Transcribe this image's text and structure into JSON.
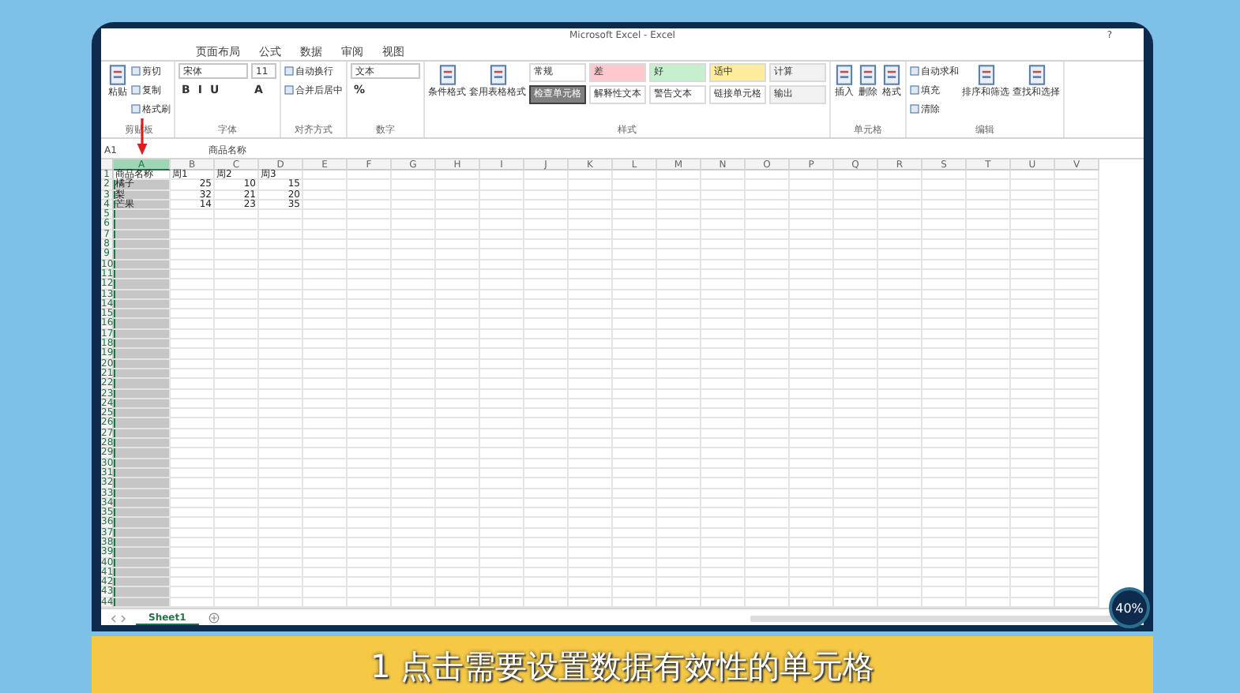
{
  "window": {
    "title": "Microsoft Excel - Excel",
    "help": "?"
  },
  "ribbon_tabs": [
    {
      "label": "页面布局"
    },
    {
      "label": "公式"
    },
    {
      "label": "数据"
    },
    {
      "label": "审阅"
    },
    {
      "label": "视图"
    }
  ],
  "ribbon_groups": [
    {
      "label": "剪贴板",
      "columns": [
        [
          {
            "kind": "large",
            "label": "粘贴"
          }
        ],
        [
          {
            "kind": "small",
            "label": "剪切"
          },
          {
            "kind": "small",
            "label": "复制"
          },
          {
            "kind": "small",
            "label": "格式刷"
          }
        ]
      ]
    },
    {
      "label": "字体",
      "columns": [
        [
          {
            "kind": "combo",
            "label": "宋体"
          },
          {
            "kind": "glyphs",
            "labels": [
              "B",
              "I",
              "U"
            ]
          }
        ],
        [
          {
            "kind": "size-combo",
            "label": "11"
          },
          {
            "kind": "glyphs",
            "labels": [
              "A"
            ]
          }
        ]
      ]
    },
    {
      "label": "对齐方式",
      "columns": [
        [
          {
            "kind": "small",
            "label": "自动换行"
          },
          {
            "kind": "small",
            "label": "合并后居中"
          }
        ]
      ]
    },
    {
      "label": "数字",
      "columns": [
        [
          {
            "kind": "combo",
            "label": "文本"
          },
          {
            "kind": "glyphs",
            "labels": [
              "%"
            ]
          }
        ]
      ]
    },
    {
      "label": "样式",
      "columns": [
        [
          {
            "kind": "large",
            "label": "条件格式"
          }
        ],
        [
          {
            "kind": "large",
            "label": "套用表格格式"
          }
        ],
        [
          {
            "kind": "style",
            "label": "常规",
            "color": "#ffffff",
            "dark": false
          },
          {
            "kind": "style",
            "label": "检查单元格",
            "color": "#7f7f7f",
            "dark": true
          }
        ],
        [
          {
            "kind": "style",
            "label": "差",
            "color": "#ffc7ce",
            "dark": false
          },
          {
            "kind": "style",
            "label": "解释性文本",
            "color": "#ffffff",
            "dark": false
          }
        ],
        [
          {
            "kind": "style",
            "label": "好",
            "color": "#c6efce",
            "dark": false
          },
          {
            "kind": "style",
            "label": "警告文本",
            "color": "#ffffff",
            "dark": false
          }
        ],
        [
          {
            "kind": "style",
            "label": "适中",
            "color": "#ffeb9c",
            "dark": false
          },
          {
            "kind": "style",
            "label": "链接单元格",
            "color": "#ffffff",
            "dark": false
          }
        ],
        [
          {
            "kind": "style",
            "label": "计算",
            "color": "#f2f2f2",
            "dark": false
          },
          {
            "kind": "style",
            "label": "输出",
            "color": "#f2f2f2",
            "dark": false
          }
        ]
      ]
    },
    {
      "label": "单元格",
      "columns": [
        [
          {
            "kind": "large",
            "label": "插入"
          }
        ],
        [
          {
            "kind": "large",
            "label": "删除"
          }
        ],
        [
          {
            "kind": "large",
            "label": "格式"
          }
        ]
      ]
    },
    {
      "label": "编辑",
      "columns": [
        [
          {
            "kind": "small",
            "label": "自动求和"
          },
          {
            "kind": "small",
            "label": "填充"
          },
          {
            "kind": "small",
            "label": "清除"
          }
        ],
        [
          {
            "kind": "large",
            "label": "排序和筛选"
          }
        ],
        [
          {
            "kind": "large",
            "label": "查找和选择"
          }
        ]
      ]
    }
  ],
  "name_box": "A1",
  "formula": "商品名称",
  "columns": [
    {
      "label": "A",
      "selected": true
    },
    {
      "label": "B",
      "selected": false
    },
    {
      "label": "C",
      "selected": false
    },
    {
      "label": "D",
      "selected": false
    },
    {
      "label": "E",
      "selected": false
    },
    {
      "label": "F",
      "selected": false
    },
    {
      "label": "G",
      "selected": false
    },
    {
      "label": "H",
      "selected": false
    },
    {
      "label": "I",
      "selected": false
    },
    {
      "label": "J",
      "selected": false
    },
    {
      "label": "K",
      "selected": false
    },
    {
      "label": "L",
      "selected": false
    },
    {
      "label": "M",
      "selected": false
    },
    {
      "label": "N",
      "selected": false
    },
    {
      "label": "O",
      "selected": false
    },
    {
      "label": "P",
      "selected": false
    },
    {
      "label": "Q",
      "selected": false
    },
    {
      "label": "R",
      "selected": false
    },
    {
      "label": "S",
      "selected": false
    },
    {
      "label": "T",
      "selected": false
    },
    {
      "label": "U",
      "selected": false
    },
    {
      "label": "V",
      "selected": false
    }
  ],
  "row_numbers": [
    "1",
    "2",
    "3",
    "4",
    "5",
    "6",
    "7",
    "8",
    "9",
    "10",
    "11",
    "12",
    "13",
    "14",
    "15",
    "16",
    "17",
    "18",
    "19",
    "20",
    "21",
    "22",
    "23",
    "24",
    "25",
    "26",
    "27",
    "28",
    "29",
    "30",
    "31",
    "32",
    "33",
    "34",
    "35",
    "36",
    "37",
    "38",
    "39",
    "40",
    "41",
    "42",
    "43",
    "44"
  ],
  "cells": [
    [
      {
        "text": "商品名称",
        "kind": "text"
      },
      {
        "text": "周1",
        "kind": "text"
      },
      {
        "text": "周2",
        "kind": "text"
      },
      {
        "text": "周3",
        "kind": "text"
      }
    ],
    [
      {
        "text": "橘子",
        "kind": "text"
      },
      {
        "text": "25",
        "kind": "number"
      },
      {
        "text": "10",
        "kind": "number"
      },
      {
        "text": "15",
        "kind": "number"
      }
    ],
    [
      {
        "text": "梨",
        "kind": "text"
      },
      {
        "text": "32",
        "kind": "number"
      },
      {
        "text": "21",
        "kind": "number"
      },
      {
        "text": "20",
        "kind": "number"
      }
    ],
    [
      {
        "text": "芒果",
        "kind": "text"
      },
      {
        "text": "14",
        "kind": "number"
      },
      {
        "text": "23",
        "kind": "number"
      },
      {
        "text": "35",
        "kind": "number"
      }
    ]
  ],
  "sheet_tabs": [
    {
      "label": "Sheet1",
      "selected": true
    }
  ],
  "progress_badge": "40%",
  "caption": "1 点击需要设置数据有效性的单元格"
}
